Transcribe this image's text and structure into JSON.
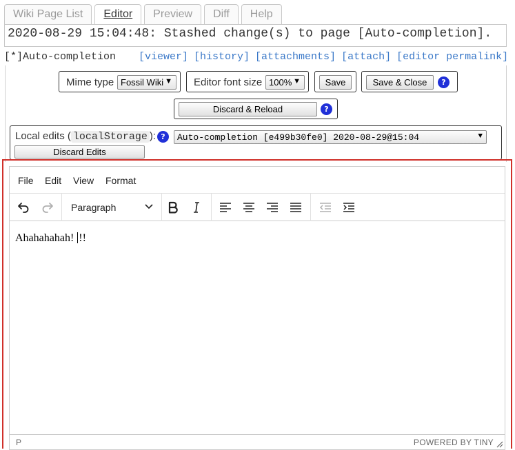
{
  "tabs": [
    {
      "label": "Wiki Page List"
    },
    {
      "label": "Editor"
    },
    {
      "label": "Preview"
    },
    {
      "label": "Diff"
    },
    {
      "label": "Help"
    }
  ],
  "message": "2020-08-29 15:04:48: Stashed change(s) to page [Auto-completion].",
  "page": {
    "name": "[*]Auto-completion",
    "links": [
      "[viewer]",
      "[history]",
      "[attachments]",
      "[attach]",
      "[editor permalink]"
    ]
  },
  "controls": {
    "mime_label": "Mime type",
    "mime_value": "Fossil Wiki",
    "font_label": "Editor font size",
    "font_value": "100%",
    "save_label": "Save",
    "save_close_label": "Save & Close",
    "discard_reload_label": "Discard & Reload",
    "help_glyph": "?",
    "local_edits_prefix": "Local edits (",
    "local_edits_code": "localStorage",
    "local_edits_suffix": "):",
    "stash_value": "Auto-completion [e499b30fe0] 2020-08-29@15:04",
    "discard_edits_label": "Discard Edits"
  },
  "editor": {
    "menu": [
      "File",
      "Edit",
      "View",
      "Format"
    ],
    "block_format": "Paragraph",
    "content_before_caret": "Ahahahahah! ",
    "content_after_caret": "!!",
    "status_path": "P",
    "branding": "POWERED BY TINY",
    "toolbar_icons": [
      "undo-icon",
      "redo-icon",
      "bold-icon",
      "italic-icon",
      "align-left-icon",
      "align-center-icon",
      "align-right-icon",
      "align-justify-icon",
      "outdent-icon",
      "indent-icon"
    ]
  }
}
